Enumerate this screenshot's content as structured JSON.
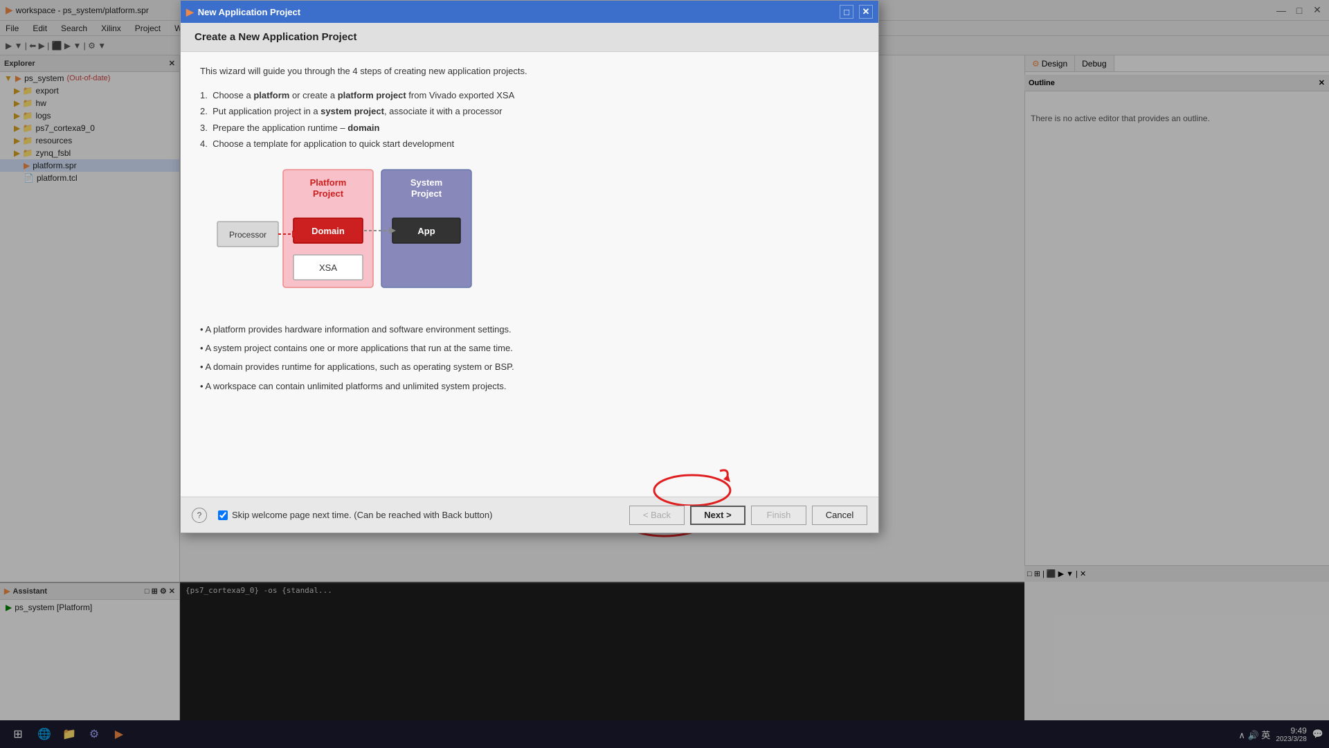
{
  "app": {
    "title": "workspace - ps_system/platform.spr",
    "icon": "▶"
  },
  "ide_menu": {
    "items": [
      "File",
      "Edit",
      "Search",
      "Xilinx",
      "Project",
      "Window"
    ]
  },
  "explorer": {
    "label": "Explorer",
    "tree": [
      {
        "level": 0,
        "label": "ps_system",
        "extra": "(Out-of-date)",
        "type": "project",
        "expanded": true
      },
      {
        "level": 1,
        "label": "export",
        "type": "folder"
      },
      {
        "level": 1,
        "label": "hw",
        "type": "folder"
      },
      {
        "level": 1,
        "label": "logs",
        "type": "folder"
      },
      {
        "level": 1,
        "label": "ps7_cortexa9_0",
        "type": "folder"
      },
      {
        "level": 1,
        "label": "resources",
        "type": "folder"
      },
      {
        "level": 1,
        "label": "zynq_fsbl",
        "type": "folder"
      },
      {
        "level": 2,
        "label": "platform.spr",
        "type": "file-red",
        "selected": true
      },
      {
        "level": 2,
        "label": "platform.tcl",
        "type": "file"
      }
    ]
  },
  "assistant": {
    "label": "Assistant",
    "items": [
      {
        "label": "ps_system [Platform]",
        "type": "platform"
      }
    ]
  },
  "right_panel": {
    "design_tab": "Design",
    "debug_tab": "Debug",
    "outline_label": "Outline",
    "outline_text": "There is no active editor that provides an outline."
  },
  "console": {
    "text": "{ps7_cortexa9_0} -os {standal..."
  },
  "dialog": {
    "titlebar_icon": "▶",
    "title": "New Application Project",
    "header": "Create a New Application Project",
    "intro": "This wizard will guide you through the 4 steps of creating new application projects.",
    "steps": [
      {
        "num": "1.",
        "text": "Choose a ",
        "bold": "platform",
        "text2": " or create a ",
        "bold2": "platform project",
        "text3": " from Vivado exported XSA"
      },
      {
        "num": "2.",
        "text": "Put application project in a ",
        "bold": "system project",
        "text2": ", associate it with a processor"
      },
      {
        "num": "3.",
        "text": "Prepare the application runtime – ",
        "bold": "domain"
      },
      {
        "num": "4.",
        "text": "Choose a template for application to quick start development"
      }
    ],
    "diagram": {
      "platform_label": "Platform Project",
      "system_label": "System Project",
      "processor_label": "Processor",
      "domain_label": "Domain",
      "app_label": "App",
      "xsa_label": "XSA"
    },
    "bullets": [
      "• A platform provides hardware information and software environment settings.",
      "• A system project contains one or more applications that run at the same time.",
      "• A domain provides runtime for applications, such as operating system or BSP.",
      "• A workspace can contain unlimited platforms and unlimited system projects."
    ],
    "checkbox_label": "Skip welcome page next time. (Can be reached with Back button)",
    "checkbox_checked": true,
    "buttons": {
      "back": "< Back",
      "next": "Next >",
      "finish": "Finish",
      "cancel": "Cancel"
    }
  },
  "taskbar": {
    "time": "9:49",
    "date": "2023/3/28",
    "icons": [
      "⊞",
      "🌐",
      "📁",
      "⚙",
      "▶"
    ]
  }
}
